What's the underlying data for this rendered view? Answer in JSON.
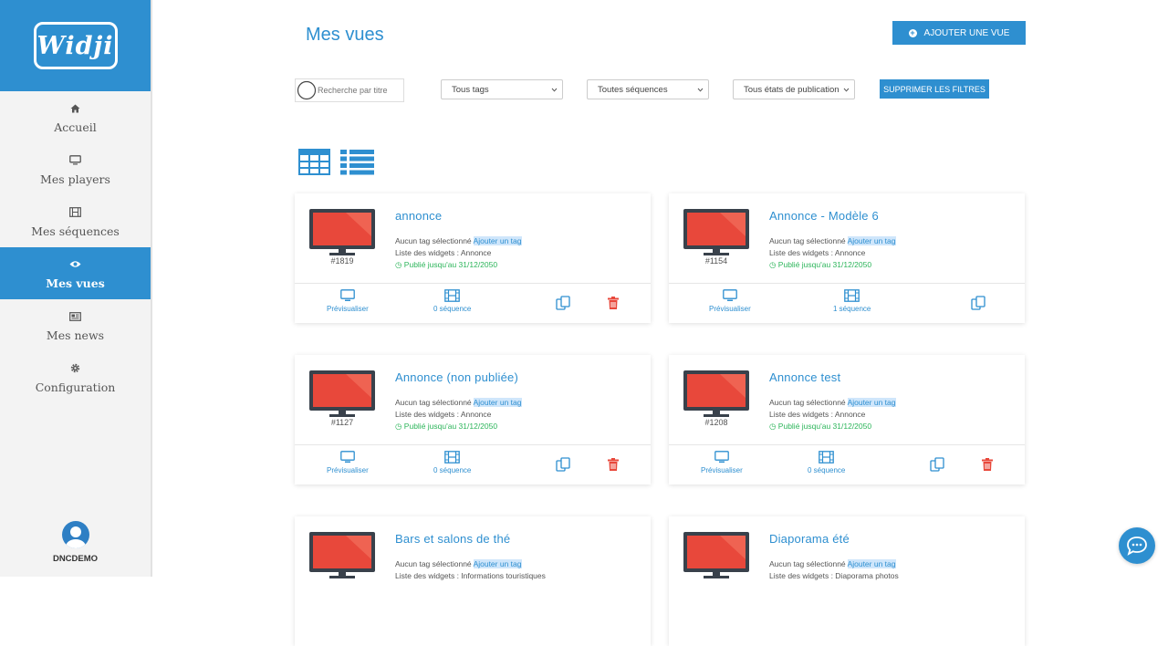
{
  "brand": {
    "logo_text": "Widji",
    "accent": "#2e8fd0"
  },
  "sidebar": {
    "items": [
      {
        "label": "Accueil",
        "icon": "home-icon"
      },
      {
        "label": "Mes players",
        "icon": "monitor-icon"
      },
      {
        "label": "Mes séquences",
        "icon": "film-icon"
      },
      {
        "label": "Mes vues",
        "icon": "eye-icon",
        "active": true
      },
      {
        "label": "Mes news",
        "icon": "newspaper-icon"
      },
      {
        "label": "Configuration",
        "icon": "gear-icon"
      }
    ],
    "user": {
      "name": "DNCDEMO"
    }
  },
  "header": {
    "title": "Mes vues",
    "add_button": "AJOUTER UNE VUE"
  },
  "filters": {
    "search_placeholder": "Recherche par titre",
    "tags": "Tous tags",
    "sequences": "Toutes séquences",
    "publication": "Tous états de publication",
    "clear_button": "SUPPRIMER LES FILTRES"
  },
  "cards": [
    {
      "id": "#1819",
      "title": "annonce",
      "no_tag": "Aucun tag sélectionné",
      "add_tag": "Ajouter un tag",
      "widgets": "Liste des widgets : Annonce",
      "published": "Publié jusqu'au 31/12/2050",
      "preview": "Prévisualiser",
      "sequences": "0 séquence",
      "deletable": true
    },
    {
      "id": "#1154",
      "title": "Annonce - Modèle 6",
      "no_tag": "Aucun tag sélectionné",
      "add_tag": "Ajouter un tag",
      "widgets": "Liste des widgets : Annonce",
      "published": "Publié jusqu'au 31/12/2050",
      "preview": "Prévisualiser",
      "sequences": "1 séquence",
      "deletable": false
    },
    {
      "id": "#1127",
      "title": "Annonce (non publiée)",
      "no_tag": "Aucun tag sélectionné",
      "add_tag": "Ajouter un tag",
      "widgets": "Liste des widgets : Annonce",
      "published": "Publié jusqu'au 31/12/2050",
      "preview": "Prévisualiser",
      "sequences": "0 séquence",
      "deletable": true
    },
    {
      "id": "#1208",
      "title": "Annonce test",
      "no_tag": "Aucun tag sélectionné",
      "add_tag": "Ajouter un tag",
      "widgets": "Liste des widgets : Annonce",
      "published": "Publié jusqu'au 31/12/2050",
      "preview": "Prévisualiser",
      "sequences": "0 séquence",
      "deletable": true
    },
    {
      "id": "",
      "title": "Bars et salons de thé",
      "no_tag": "Aucun tag sélectionné",
      "add_tag": "Ajouter un tag",
      "widgets": "Liste des widgets : Informations touristiques",
      "published": "",
      "preview": "",
      "sequences": "",
      "deletable": false
    },
    {
      "id": "",
      "title": "Diaporama été",
      "no_tag": "Aucun tag sélectionné",
      "add_tag": "Ajouter un tag",
      "widgets": "Liste des widgets : Diaporama photos",
      "published": "",
      "preview": "",
      "sequences": "",
      "deletable": false
    }
  ]
}
